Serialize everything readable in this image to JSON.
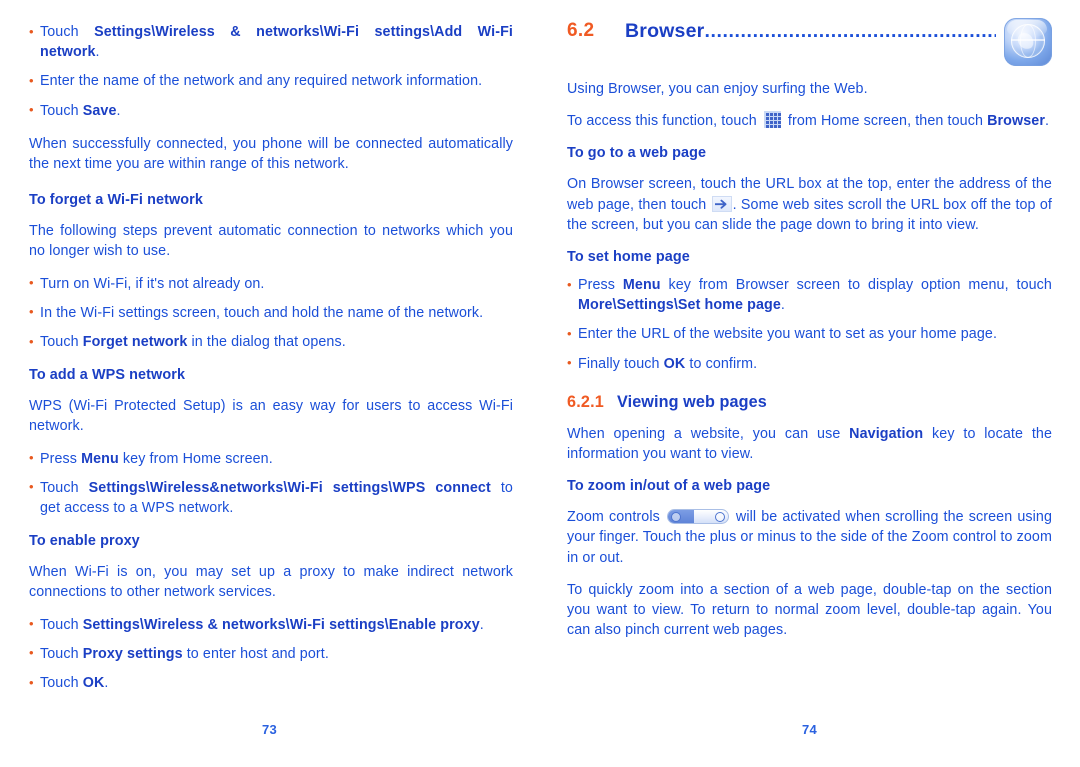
{
  "document": {
    "type": "user-manual-spread",
    "colors": {
      "body_blue": "#1b4fd8",
      "bold_blue": "#1b3fc4",
      "accent_orange": "#f05a23",
      "bullet_orange": "#e8591f"
    }
  },
  "left_page": {
    "page_number": "73",
    "blocks": [
      {
        "bullet_1_pre": "Touch ",
        "bullet_1_bold": "Settings\\Wireless & networks\\Wi-Fi settings\\Add Wi-Fi network",
        "bullet_1_post": "."
      },
      {
        "bullet_2": "Enter the name of the network and any required network information."
      },
      {
        "bullet_3_pre": "Touch ",
        "bullet_3_bold": "Save",
        "bullet_3_post": "."
      }
    ],
    "paragraph_connected": "When successfully connected, you phone will be connected automatically the next time you are within range of this network.",
    "heading_forget": "To forget a Wi-Fi network",
    "paragraph_forget": "The following steps prevent automatic connection to networks which you no longer wish to use.",
    "forget_bullets": {
      "b1": "Turn on Wi-Fi, if it's not already on.",
      "b2": "In the Wi-Fi settings screen, touch and hold the name of the network.",
      "b3_pre": "Touch ",
      "b3_bold": "Forget network",
      "b3_post": " in the dialog that opens."
    },
    "heading_wps": "To add a WPS network",
    "paragraph_wps": "WPS (Wi-Fi Protected Setup) is an easy way for users to access Wi-Fi network.",
    "wps_bullets": {
      "b1_pre": "Press ",
      "b1_bold": "Menu",
      "b1_post": " key from Home screen.",
      "b2_pre": "Touch ",
      "b2_bold": "Settings\\Wireless&networks\\Wi-Fi settings\\WPS connect",
      "b2_post": " to get access to a WPS network."
    },
    "heading_proxy": "To enable proxy",
    "paragraph_proxy": "When Wi-Fi is on, you may set up a proxy to make indirect network connections to other network services.",
    "proxy_bullets": {
      "b1_pre": "Touch ",
      "b1_bold": "Settings\\Wireless & networks\\Wi-Fi settings\\Enable proxy",
      "b1_post": ".",
      "b2_pre": "Touch ",
      "b2_bold": "Proxy settings",
      "b2_post": " to enter host and port.",
      "b3_pre": "Touch ",
      "b3_bold": "OK",
      "b3_post": "."
    }
  },
  "right_page": {
    "page_number": "74",
    "section": {
      "number": "6.2",
      "title": "Browser",
      "leader_dots": "..................................................",
      "icon": "browser-globe-icon"
    },
    "intro": "Using Browser, you can enjoy surfing the Web.",
    "access_pre": "To access this function, touch ",
    "access_icon": "app-launcher-grid-icon",
    "access_mid": " from Home screen, then touch ",
    "access_bold": "Browser",
    "access_post": ".",
    "heading_goto": "To go to a web page",
    "goto_pre": "On Browser screen, touch the URL box at the top, enter the address of the web page, then touch ",
    "goto_icon": "go-arrow-icon",
    "goto_post": ". Some web sites scroll the URL box off the top of the screen, but you can slide the page down to bring it into view.",
    "heading_sethome": "To set home page",
    "sethome_bullets": {
      "b1_pre": "Press ",
      "b1_bold1": "Menu",
      "b1_mid": " key from Browser screen to display option menu, touch ",
      "b1_bold2": "More\\Settings\\Set home page",
      "b1_post": ".",
      "b2": "Enter the URL of the website you want to set as your home page.",
      "b3_pre": "Finally touch ",
      "b3_bold": "OK",
      "b3_post": " to confirm."
    },
    "subsection": {
      "number": "6.2.1",
      "title": "Viewing web pages"
    },
    "viewing_pre": "When opening a website, you can use ",
    "viewing_bold": "Navigation",
    "viewing_post": " key to locate the information you want to view.",
    "heading_zoom": "To zoom in/out of a web page",
    "zoom_pre": "Zoom controls ",
    "zoom_icon": "zoom-control-slider-icon",
    "zoom_post": " will be activated when scrolling the screen using your finger. Touch the plus or minus to the side of the Zoom control to zoom in or out.",
    "zoom_para2": "To quickly zoom into a section of a web page, double-tap on the section you want to view. To return to normal zoom level, double-tap again. You can also pinch current web pages."
  }
}
